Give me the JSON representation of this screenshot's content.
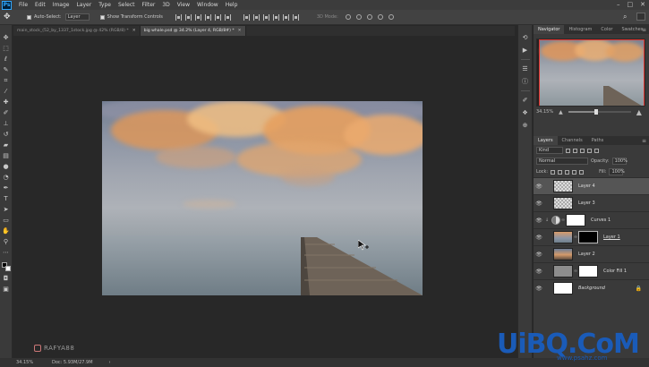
{
  "menu": {
    "logo": "Ps",
    "items": [
      "File",
      "Edit",
      "Image",
      "Layer",
      "Type",
      "Select",
      "Filter",
      "3D",
      "View",
      "Window",
      "Help"
    ],
    "window_controls": [
      "–",
      "□",
      "✕"
    ]
  },
  "options": {
    "auto_select_label": "Auto-Select:",
    "auto_select_value": "Layer",
    "transform_label": "Show Transform Controls",
    "mode_3d_label": "3D Mode:"
  },
  "tabs": [
    {
      "label": "main_stock_(52_by_1337_1stock.jpg @ 42% (RGB/8) *",
      "close": "✕"
    },
    {
      "label": "big whale.psd @ 34.2% (Layer 4, RGB/8#) *",
      "close": "✕"
    }
  ],
  "status": {
    "zoom": "34.15%",
    "doc": "Doc: 5.93M/27.9M",
    "arrow": "›"
  },
  "watermark": {
    "handle": "RAFYA88",
    "site_logo": "UiBQ.CoM",
    "site_url": "www.psahz.com"
  },
  "navigator": {
    "tabs": [
      "Navigator",
      "Histogram",
      "Color",
      "Swatches"
    ],
    "zoom_value": "34.15%",
    "zoom_level": 0.45
  },
  "layers_panel": {
    "tabs": [
      "Layers",
      "Channels",
      "Paths"
    ],
    "kind": "Kind",
    "blend_mode": "Normal",
    "opacity_label": "Opacity:",
    "opacity": "100%",
    "lock_label": "Lock:",
    "fill_label": "Fill:",
    "fill": "100%",
    "layers": [
      {
        "name": "Layer 4",
        "type": "pixel-transparent",
        "selected": true
      },
      {
        "name": "Layer 3",
        "type": "pixel-transparent",
        "selected": false
      },
      {
        "name": "Curves 1",
        "type": "adjustment-clipped",
        "selected": false
      },
      {
        "name": "Layer 1",
        "type": "pixel-with-mask",
        "selected": false
      },
      {
        "name": "Layer 2",
        "type": "pixel-sky",
        "selected": false
      },
      {
        "name": "Color Fill 1",
        "type": "fill-with-mask",
        "selected": false
      },
      {
        "name": "Background",
        "type": "background",
        "selected": false
      }
    ]
  },
  "colors": {
    "accent_red": "#e0342f",
    "site_blue": "#1a5bb8"
  }
}
